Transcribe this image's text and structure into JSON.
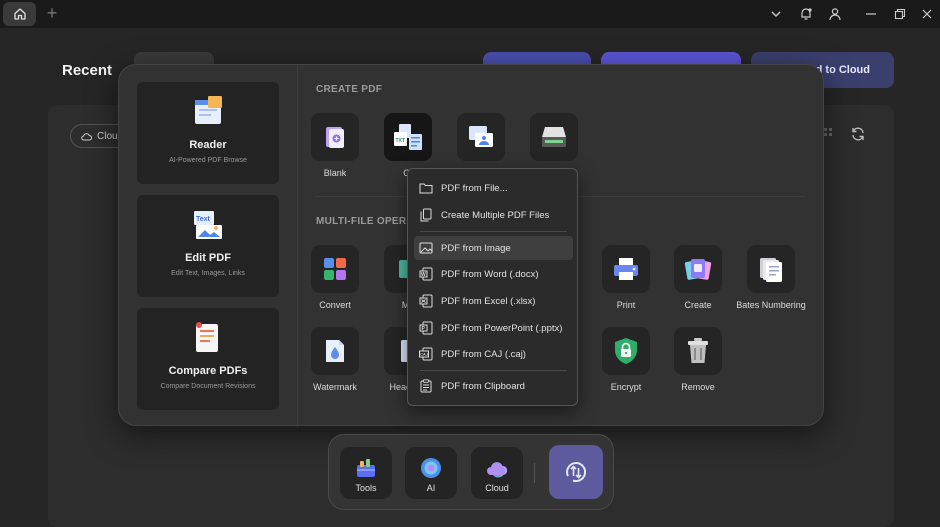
{
  "page": {
    "recent_title": "Recent",
    "cloud_chip_label": "Cloud",
    "upload_cloud_label": "d to Cloud"
  },
  "popup": {
    "side_cards": [
      {
        "title": "Reader",
        "subtitle": "AI-Powered PDF Browse",
        "icon": "reader-icon"
      },
      {
        "title": "Edit PDF",
        "subtitle": "Edit Text, Images, Links",
        "icon": "edit-pdf-icon"
      },
      {
        "title": "Compare PDFs",
        "subtitle": "Compare Document Revisions",
        "icon": "compare-pdfs-icon"
      }
    ],
    "create_pdf_title": "CREATE PDF",
    "multi_file_title": "MULTI-FILE OPERAT",
    "create_tools": [
      {
        "label": "Blank",
        "icon": "blank-pdf-icon"
      },
      {
        "label": "Ot",
        "icon": "other-pdf-icon"
      },
      {
        "label": "",
        "icon": "scan-to-pdf-icon"
      },
      {
        "label": "",
        "icon": "scanner-icon"
      }
    ],
    "multi_tools_row1": [
      {
        "label": "Convert",
        "icon": "convert-icon"
      },
      {
        "label": "Me",
        "icon": "merge-icon"
      },
      {
        "label": "e",
        "icon": "compress-icon"
      },
      {
        "label": "Print",
        "icon": "print-icon"
      },
      {
        "label": "Create",
        "icon": "create-icon"
      },
      {
        "label": "Bates Numbering",
        "icon": "bates-numbering-icon"
      }
    ],
    "multi_tools_row2": [
      {
        "label": "Watermark",
        "icon": "watermark-icon"
      },
      {
        "label": "Header a",
        "icon": "header-footer-icon"
      },
      {
        "label": "Encrypt",
        "icon": "encrypt-icon"
      },
      {
        "label": "Remove",
        "icon": "remove-icon"
      }
    ]
  },
  "menu": {
    "items": [
      {
        "label": "PDF from File...",
        "icon": "folder-icon"
      },
      {
        "label": "Create Multiple PDF Files",
        "icon": "multiple-files-icon"
      },
      {
        "label": "PDF from Image",
        "icon": "image-icon",
        "active": true
      },
      {
        "label": "PDF from Word (.docx)",
        "icon": "word-icon"
      },
      {
        "label": "PDF from Excel (.xlsx)",
        "icon": "excel-icon"
      },
      {
        "label": "PDF from PowerPoint (.pptx)",
        "icon": "powerpoint-icon"
      },
      {
        "label": "PDF from CAJ (.caj)",
        "icon": "caj-icon"
      },
      {
        "label": "PDF from Clipboard",
        "icon": "clipboard-icon"
      }
    ]
  },
  "dock": {
    "items": [
      {
        "label": "Tools",
        "icon": "tools-icon"
      },
      {
        "label": "AI",
        "icon": "ai-icon"
      },
      {
        "label": "Cloud",
        "icon": "cloud-icon"
      }
    ]
  },
  "colors": {
    "accent": "#6b63e0",
    "dock_active": "#5d5a9e"
  }
}
